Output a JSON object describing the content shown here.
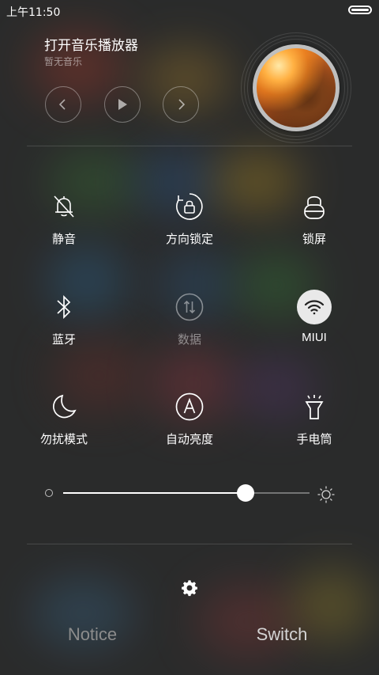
{
  "status_bar": {
    "time": "上午11:50"
  },
  "player": {
    "title": "打开音乐播放器",
    "subtitle": "暂无音乐",
    "controls": {
      "prev_icon": "chevron-left-icon",
      "play_icon": "play-icon",
      "next_icon": "chevron-right-icon"
    }
  },
  "toggles": [
    {
      "id": "mute",
      "label": "静音",
      "icon": "bell-off-icon",
      "state": "off"
    },
    {
      "id": "rotation-lock",
      "label": "方向锁定",
      "icon": "rotation-lock-icon",
      "state": "off"
    },
    {
      "id": "lock-screen",
      "label": "锁屏",
      "icon": "lock-icon",
      "state": "off"
    },
    {
      "id": "bluetooth",
      "label": "蓝牙",
      "icon": "bluetooth-icon",
      "state": "off"
    },
    {
      "id": "data",
      "label": "数据",
      "icon": "data-icon",
      "state": "disabled"
    },
    {
      "id": "wifi",
      "label": "MIUI",
      "icon": "wifi-icon",
      "state": "on"
    },
    {
      "id": "dnd",
      "label": "勿扰模式",
      "icon": "moon-icon",
      "state": "off"
    },
    {
      "id": "auto-brightness",
      "label": "自动亮度",
      "icon": "auto-brightness-icon",
      "state": "off"
    },
    {
      "id": "flashlight",
      "label": "手电筒",
      "icon": "flashlight-icon",
      "state": "off"
    }
  ],
  "brightness": {
    "level": 0.74
  },
  "bottom_tabs": {
    "notice": "Notice",
    "switch": "Switch",
    "active": "switch"
  },
  "colors": {
    "accent": "#ffffff",
    "wifi_active_bg": "#e9e9e9",
    "text_secondary": "#a6a6a6",
    "tab_inactive": "#8c8c8c"
  }
}
